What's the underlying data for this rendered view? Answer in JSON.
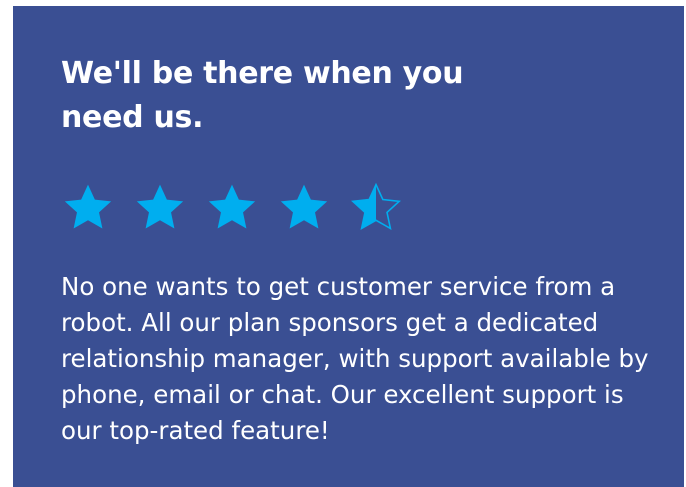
{
  "card": {
    "headline": "We'll be there when you need us.",
    "rating": {
      "value": 4.5,
      "max": 5,
      "star_icon": "star-icon",
      "fill_color": "#00aeef"
    },
    "body": "No one wants to get customer service from a robot. All our plan sponsors get a dedicated relationship manager, with support available by phone, email or chat. Our excellent support is our top-rated feature!"
  },
  "colors": {
    "card_background": "#3a4f93",
    "text": "#ffffff",
    "star": "#00aeef"
  }
}
